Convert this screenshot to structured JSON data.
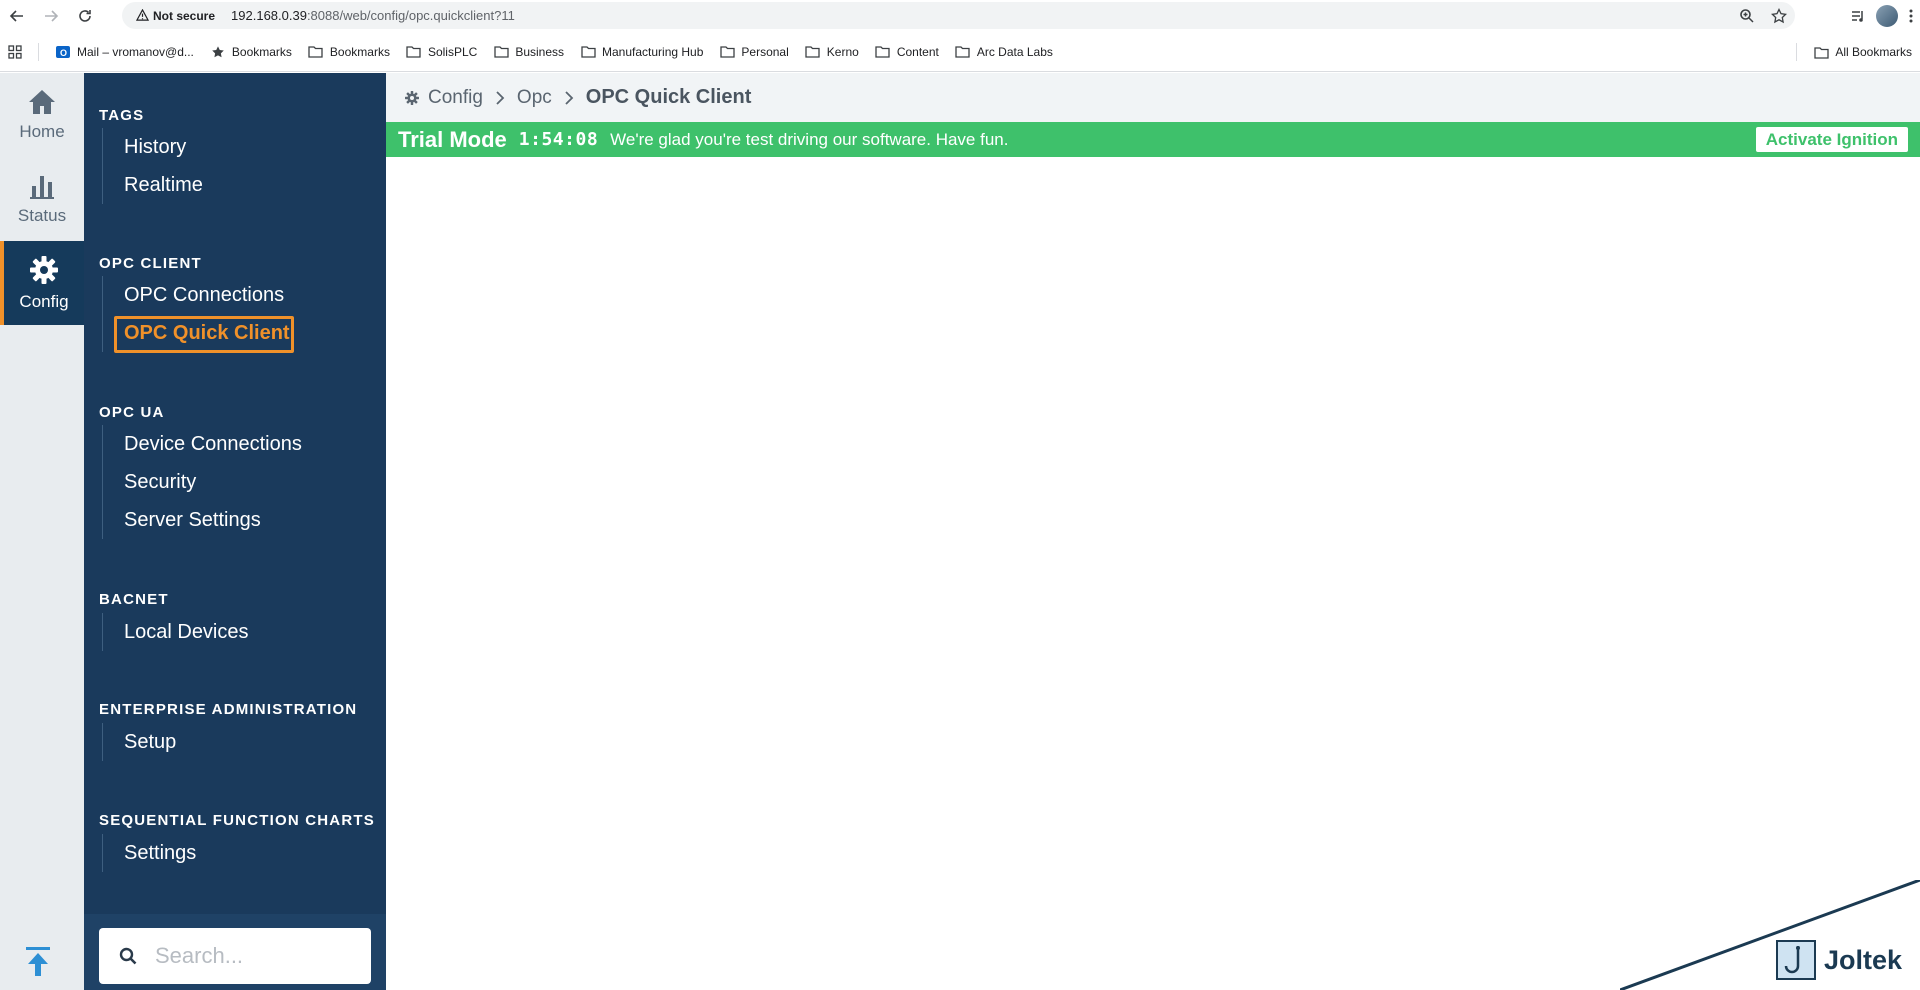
{
  "browser": {
    "security_label": "Not secure",
    "url_host": "192.168.0.39",
    "url_rest": ":8088/web/config/opc.quickclient?11"
  },
  "bookmarks": [
    {
      "label": "Mail – vromanov@d...",
      "icon": "outlook-icon"
    },
    {
      "label": "Bookmarks",
      "icon": "star-icon"
    },
    {
      "label": "Bookmarks",
      "icon": "folder-icon"
    },
    {
      "label": "SolisPLC",
      "icon": "folder-icon"
    },
    {
      "label": "Business",
      "icon": "folder-icon"
    },
    {
      "label": "Manufacturing Hub",
      "icon": "folder-icon"
    },
    {
      "label": "Personal",
      "icon": "folder-icon"
    },
    {
      "label": "Kerno",
      "icon": "folder-icon"
    },
    {
      "label": "Content",
      "icon": "folder-icon"
    },
    {
      "label": "Arc Data Labs",
      "icon": "folder-icon"
    }
  ],
  "all_bookmarks": "All Bookmarks",
  "rail": {
    "home": "Home",
    "status": "Status",
    "config": "Config"
  },
  "sidebar": {
    "sections": [
      {
        "title": "TAGS",
        "items": [
          "History",
          "Realtime"
        ]
      },
      {
        "title": "OPC CLIENT",
        "items": [
          "OPC Connections",
          "OPC Quick Client"
        ]
      },
      {
        "title": "OPC UA",
        "items": [
          "Device Connections",
          "Security",
          "Server Settings"
        ]
      },
      {
        "title": "BACNET",
        "items": [
          "Local Devices"
        ]
      },
      {
        "title": "ENTERPRISE ADMINISTRATION",
        "items": [
          "Setup"
        ]
      },
      {
        "title": "SEQUENTIAL FUNCTION CHARTS",
        "items": [
          "Settings"
        ]
      }
    ],
    "selected": "OPC Quick Client",
    "search_placeholder": "Search..."
  },
  "breadcrumb": {
    "root": "Config",
    "middle": "Opc",
    "current": "OPC Quick Client"
  },
  "trial": {
    "title": "Trial Mode",
    "timer": "1:54:08",
    "message": "We're glad you're test driving our software. Have fun.",
    "button": "Activate Ignition"
  },
  "logo": "Joltek",
  "colors": {
    "sidebar_bg": "#1a3a5c",
    "accent": "#f0912a",
    "trial_green": "#3ec16b"
  }
}
